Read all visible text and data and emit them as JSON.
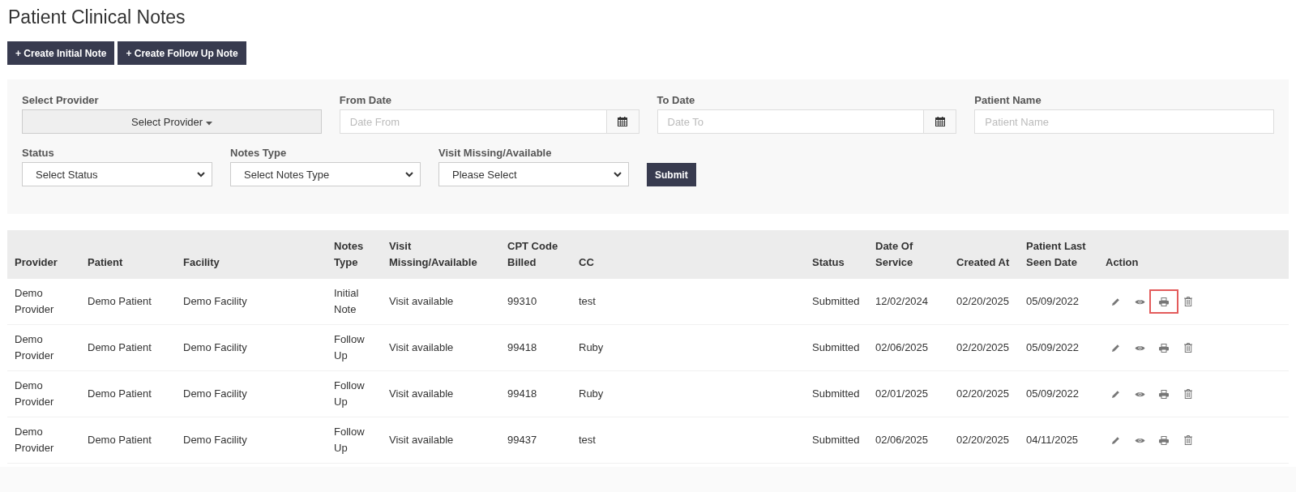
{
  "title": "Patient Clinical Notes",
  "buttons": [
    {
      "icon": "+",
      "label": "Create Initial Note"
    },
    {
      "icon": "+",
      "label": "Create Follow Up Note"
    }
  ],
  "filters": {
    "provider": {
      "label": "Select Provider",
      "value": "Select Provider"
    },
    "from_date": {
      "label": "From Date",
      "placeholder": "Date From"
    },
    "to_date": {
      "label": "To Date",
      "placeholder": "Date To"
    },
    "patient_name": {
      "label": "Patient Name",
      "placeholder": "Patient Name"
    },
    "selects": [
      {
        "label": "Status",
        "value": "Select Status"
      },
      {
        "label": "Notes Type",
        "value": "Select Notes Type"
      },
      {
        "label": "Visit Missing/Available",
        "value": "Please Select"
      }
    ],
    "submit": "Submit"
  },
  "table": {
    "columns": [
      "Provider",
      "Patient",
      "Facility",
      "Notes Type",
      "Visit Missing/Available",
      "CPT Code Billed",
      "CC",
      "Status",
      "Date Of Service",
      "Created At",
      "Patient Last Seen Date",
      "Action"
    ],
    "rows": [
      {
        "cells": [
          "Demo Provider",
          "Demo Patient",
          "Demo Facility",
          "Initial Note",
          "Visit available",
          "99310",
          "test",
          "Submitted",
          "12/02/2024",
          "02/20/2025",
          "05/09/2022"
        ],
        "actions": [
          {
            "kind": "edit",
            "focused": false
          },
          {
            "kind": "view",
            "focused": false
          },
          {
            "kind": "print",
            "focused": true
          },
          {
            "kind": "delete",
            "focused": false
          }
        ]
      },
      {
        "cells": [
          "Demo Provider",
          "Demo Patient",
          "Demo Facility",
          "Follow Up",
          "Visit available",
          "99418",
          "Ruby",
          "Submitted",
          "02/06/2025",
          "02/20/2025",
          "05/09/2022"
        ],
        "actions": [
          {
            "kind": "edit",
            "focused": false
          },
          {
            "kind": "view",
            "focused": false
          },
          {
            "kind": "print",
            "focused": false
          },
          {
            "kind": "delete",
            "focused": false
          }
        ]
      },
      {
        "cells": [
          "Demo Provider",
          "Demo Patient",
          "Demo Facility",
          "Follow Up",
          "Visit available",
          "99418",
          "Ruby",
          "Submitted",
          "02/01/2025",
          "02/20/2025",
          "05/09/2022"
        ],
        "actions": [
          {
            "kind": "edit",
            "focused": false
          },
          {
            "kind": "view",
            "focused": false
          },
          {
            "kind": "print",
            "focused": false
          },
          {
            "kind": "delete",
            "focused": false
          }
        ]
      },
      {
        "cells": [
          "Demo Provider",
          "Demo Patient",
          "Demo Facility",
          "Follow Up",
          "Visit available",
          "99437",
          "test",
          "Submitted",
          "02/06/2025",
          "02/20/2025",
          "04/11/2025"
        ],
        "actions": [
          {
            "kind": "edit",
            "focused": false
          },
          {
            "kind": "view",
            "focused": false
          },
          {
            "kind": "print",
            "focused": false
          },
          {
            "kind": "delete",
            "focused": false
          }
        ]
      }
    ]
  }
}
